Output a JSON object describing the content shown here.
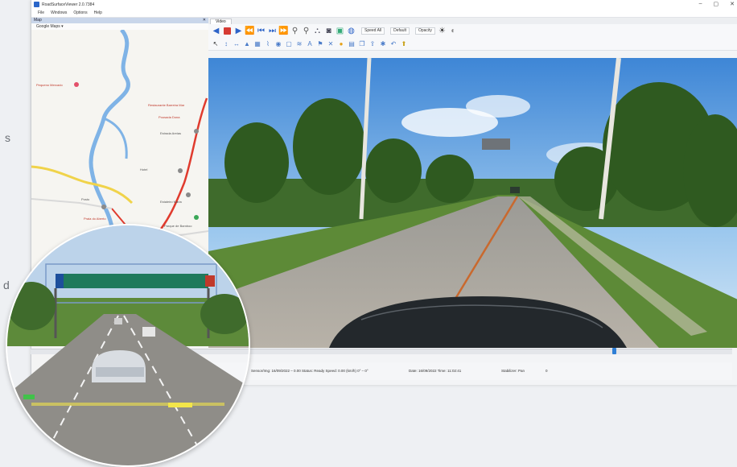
{
  "window": {
    "title": "RoadSurfaceViewer 2.0.7384",
    "controls": [
      "–",
      "▢",
      "✕"
    ]
  },
  "menu": [
    "File",
    "Windows",
    "Options",
    "Help"
  ],
  "map_panel": {
    "header": "Map",
    "close": "✕",
    "layer_select": "Google Maps ▾",
    "places": [
      "Pequeno Mercado",
      "Restaurante Barreira Mar",
      "Pousada Dona",
      "Estrada Areias",
      "Hotel",
      "Estaleiro Maria",
      "Posto",
      "Praia do Aberto",
      "Parque de Bamboo"
    ]
  },
  "video_panel": {
    "tab": "Video",
    "dropdowns": [
      "Speed All",
      "Default",
      "Opacity"
    ],
    "brightness_icon": "brightness-icon"
  },
  "status": {
    "item1": "Sensor/Img: 16/09/2022 – 0.00  Status: Ready  Speed: 0.00 (km/h)  0° – 0°",
    "item2": "Date: 16/09/2022   Time: 11:02:41",
    "item3": "Stabilizer: Pan",
    "item4": "0"
  },
  "edge_text": {
    "top": "s",
    "bottom": "d"
  },
  "colors": {
    "accent_blue": "#2d63c8",
    "record_red": "#d63b33",
    "route_red": "#e03b2e",
    "river_blue": "#7fb3e6",
    "road_yellow": "#f0d34a",
    "sign_green": "#1f7a5c"
  }
}
